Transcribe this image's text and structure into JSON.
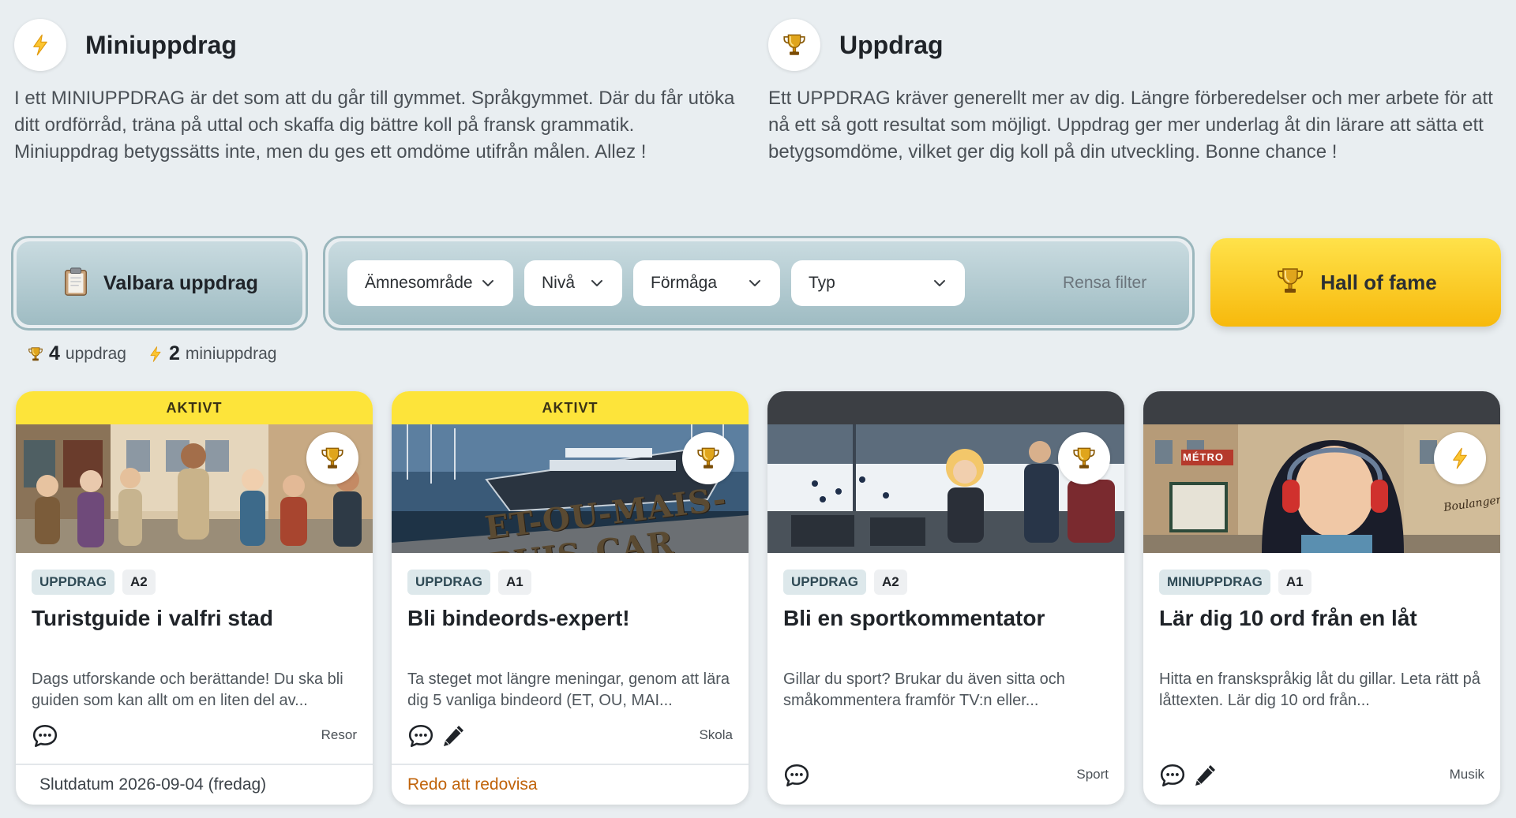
{
  "intro": {
    "mini": {
      "title": "Miniuppdrag",
      "text": "I ett MINIUPPDRAG är det som att du går till gymmet. Språkgymmet. Där du får utöka ditt ordförråd, träna på uttal och skaffa dig bättre koll på fransk grammatik. Miniuppdrag betygssätts inte, men du ges ett omdöme utifrån målen. Allez !",
      "icon": "lightning-icon"
    },
    "uppdrag": {
      "title": "Uppdrag",
      "text": "Ett UPPDRAG kräver generellt mer av dig. Längre förberedelser och mer arbete för att nå ett så gott resultat som möjligt. Uppdrag ger mer underlag åt din lärare att sätta ett betygsomdöme, vilket ger dig koll på din utveckling. Bonne chance !",
      "icon": "trophy-icon"
    }
  },
  "toolbar": {
    "valbara_label": "Valbara uppdrag",
    "filters": [
      "Ämnesområde",
      "Nivå",
      "Förmåga",
      "Typ"
    ],
    "clear_label": "Rensa filter",
    "hall_of_fame_label": "Hall of fame"
  },
  "counts": {
    "uppdrag_count": "4",
    "uppdrag_label": "uppdrag",
    "mini_count": "2",
    "mini_label": "miniuppdrag"
  },
  "colors": {
    "accent_yellow": "#fde43a",
    "hof_yellow": "#f7b90c",
    "teal": "#9fbcc3",
    "ready_orange": "#c0630a"
  },
  "cards": [
    {
      "status": "AKTIVT",
      "icon": "trophy-icon",
      "type": "UPPDRAG",
      "level": "A2",
      "title": "Turistguide i valfri stad",
      "desc": "Dags utforskande och berättande! Du ska bli guiden som kan allt om en liten del av...",
      "category": "Resor",
      "footer": "Slutdatum 2026-09-04 (fredag)"
    },
    {
      "status": "AKTIVT",
      "icon": "trophy-icon",
      "type": "UPPDRAG",
      "level": "A1",
      "title": "Bli bindeords-expert!",
      "desc": "Ta steget mot längre meningar, genom att lära dig 5 vanliga bindeord (ET, OU, MAI...",
      "category": "Skola",
      "footer": "Redo att redovisa",
      "image_text": "ET-OU-MAIS-PUIS-CAR"
    },
    {
      "status": "",
      "icon": "trophy-icon",
      "type": "UPPDRAG",
      "level": "A2",
      "title": "Bli en sportkommentator",
      "desc": "Gillar du sport? Brukar du även sitta och småkommentera framför TV:n eller...",
      "category": "Sport"
    },
    {
      "status": "",
      "icon": "lightning-icon",
      "type": "MINIUPPDRAG",
      "level": "A1",
      "title": "Lär dig 10 ord från en låt",
      "desc": "Hitta en franskspråkig låt du gillar. Leta rätt på låttexten. Lär dig 10 ord från...",
      "category": "Musik",
      "image_text": [
        "MÉTRO",
        "Boulangerie"
      ]
    }
  ]
}
